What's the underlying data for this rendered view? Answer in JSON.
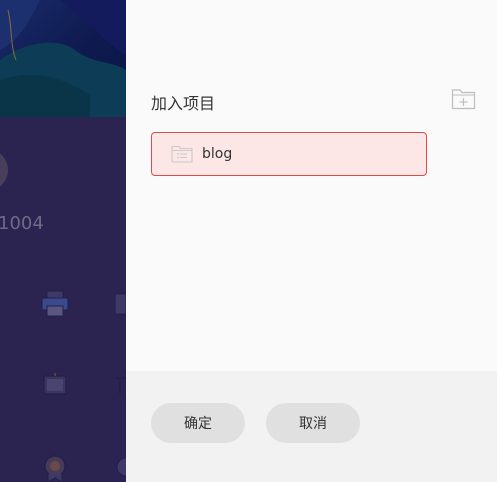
{
  "background": {
    "user_id_partial": "1004"
  },
  "panel": {
    "title": "加入项目",
    "add_folder_icon": "folder-plus-icon",
    "projects": [
      {
        "name": "blog",
        "icon": "folder-list-icon",
        "selected": true
      }
    ]
  },
  "footer": {
    "confirm_label": "确定",
    "cancel_label": "取消"
  },
  "colors": {
    "selected_bg": "#fce6e6",
    "selected_border": "#e04a4a",
    "panel_bg": "#fafafa",
    "footer_bg": "#f2f2f2",
    "overlay": "#2b2350"
  }
}
